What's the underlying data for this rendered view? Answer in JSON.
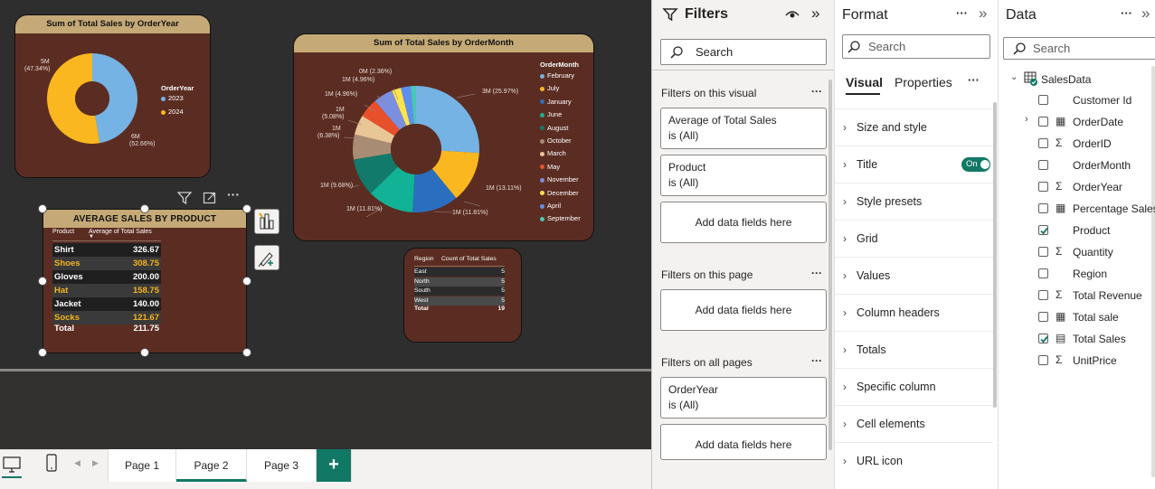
{
  "year_chart": {
    "title": "Sum of Total Sales by OrderYear",
    "legend_title": "OrderYear",
    "labels": [
      "5M",
      "(47.34%)",
      "6M",
      "(52.66%)"
    ]
  },
  "month_chart": {
    "title": "Sum of Total Sales by OrderMonth",
    "legend_title": "OrderMonth",
    "labels": {
      "feb": "3M (25.97%)",
      "jul": "1M (13.11%)",
      "jan": "1M (11.81%)",
      "jun": "1M (11.81%)",
      "aug": "1M (9.68%)",
      "oct1": "1M",
      "oct2": "(6.38%)",
      "mar1": "1M",
      "mar2": "(5.08%)",
      "may": "1M (4.96%)",
      "nov": "1M (4.96%)",
      "dec": "0M (2.36%)"
    }
  },
  "product_table": {
    "title": "AVERAGE SALES BY PRODUCT",
    "col_product": "Product",
    "col_avg": "Average of Total Sales",
    "rows": [
      {
        "product": "Shirt",
        "value": "326.67"
      },
      {
        "product": "Shoes",
        "value": "308.75"
      },
      {
        "product": "Gloves",
        "value": "200.00"
      },
      {
        "product": "Hat",
        "value": "158.75"
      },
      {
        "product": "Jacket",
        "value": "140.00"
      },
      {
        "product": "Socks",
        "value": "121.67"
      }
    ],
    "total_label": "Total",
    "total_value": "211.75"
  },
  "region_table": {
    "col_region": "Region",
    "col_count": "Count of Total Sales",
    "rows": [
      {
        "region": "East",
        "count": "5"
      },
      {
        "region": "North",
        "count": "5"
      },
      {
        "region": "South",
        "count": "5"
      },
      {
        "region": "West",
        "count": "5"
      }
    ],
    "total_label": "Total",
    "total_value": "19"
  },
  "chart_data": [
    {
      "type": "pie",
      "title": "Sum of Total Sales by OrderYear",
      "legend": "right",
      "categories": [
        "2023",
        "2024"
      ],
      "values": [
        5.3,
        5.9
      ],
      "percent": [
        47.34,
        52.66
      ],
      "colors": [
        "#74b3e4",
        "#fbb71f"
      ]
    },
    {
      "type": "pie",
      "title": "Sum of Total Sales by OrderMonth",
      "legend": "right",
      "categories": [
        "February",
        "July",
        "January",
        "June",
        "August",
        "October",
        "March",
        "May",
        "November",
        "December",
        "April",
        "September"
      ],
      "percent": [
        25.97,
        13.11,
        11.81,
        11.81,
        9.68,
        6.38,
        5.08,
        4.96,
        4.96,
        2.36,
        2.5,
        1.38
      ],
      "colors": [
        "#74b3e4",
        "#fbb71f",
        "#2a6fbf",
        "#12b296",
        "#127a6a",
        "#a88c73",
        "#e8c696",
        "#e8502b",
        "#7b8fe0",
        "#fde44c",
        "#5e8ff0",
        "#49c7b4"
      ]
    }
  ],
  "filters": {
    "title": "Filters",
    "search": "Search",
    "on_visual": "Filters on this visual",
    "cards_visual": [
      {
        "name": "Average of Total Sales",
        "state": "is (All)"
      },
      {
        "name": "Product",
        "state": "is (All)"
      }
    ],
    "add_fields": "Add data fields here",
    "on_page": "Filters on this page",
    "on_all": "Filters on all pages",
    "card_all": {
      "name": "OrderYear",
      "state": "is (All)"
    },
    "more": "···"
  },
  "format": {
    "title": "Format",
    "search": "Search",
    "tab_visual": "Visual",
    "tab_properties": "Properties",
    "rows": [
      "Size and style",
      "Title",
      "Style presets",
      "Grid",
      "Values",
      "Column headers",
      "Totals",
      "Specific column",
      "Cell elements",
      "URL icon"
    ],
    "title_toggle": "On"
  },
  "data": {
    "title": "Data",
    "search": "Search",
    "table_name": "SalesData",
    "fields": [
      {
        "name": "Customer Id",
        "checked": false,
        "icon": ""
      },
      {
        "name": "OrderDate",
        "checked": false,
        "icon": "calendar-icon"
      },
      {
        "name": "OrderID",
        "checked": false,
        "icon": "sigma-icon"
      },
      {
        "name": "OrderMonth",
        "checked": false,
        "icon": ""
      },
      {
        "name": "OrderYear",
        "checked": false,
        "icon": "sigma-icon"
      },
      {
        "name": "Percentage Sales",
        "checked": false,
        "icon": "calculator-icon"
      },
      {
        "name": "Product",
        "checked": true,
        "icon": ""
      },
      {
        "name": "Quantity",
        "checked": false,
        "icon": "sigma-icon"
      },
      {
        "name": "Region",
        "checked": false,
        "icon": ""
      },
      {
        "name": "Total Revenue",
        "checked": false,
        "icon": "sigma-icon"
      },
      {
        "name": "Total sale",
        "checked": false,
        "icon": "calculator-icon"
      },
      {
        "name": "Total Sales",
        "checked": true,
        "icon": "measure-icon"
      },
      {
        "name": "UnitPrice",
        "checked": false,
        "icon": "sigma-icon"
      }
    ]
  },
  "pages": [
    "Page 1",
    "Page 2",
    "Page 3"
  ],
  "add_page": "+"
}
